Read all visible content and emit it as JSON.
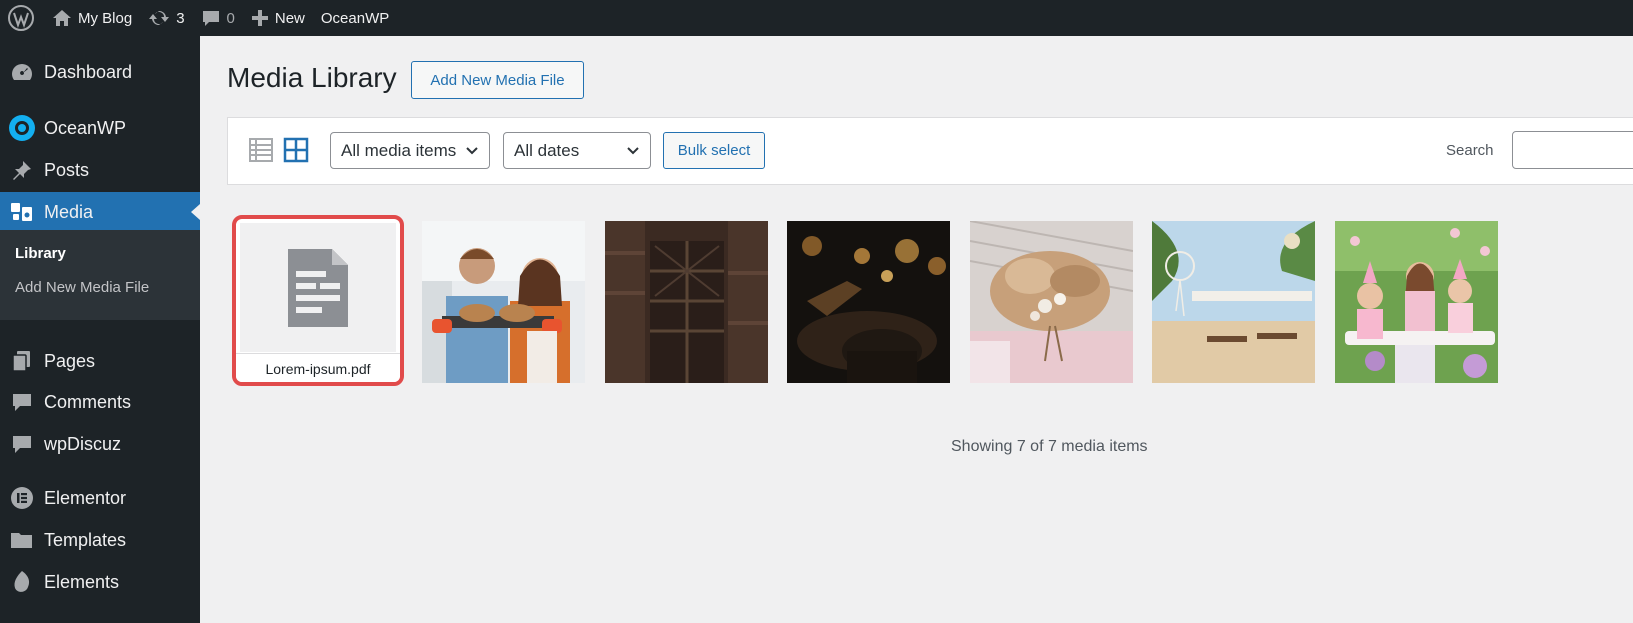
{
  "adminbar": {
    "site_name": "My Blog",
    "updates_count": "3",
    "comments_count": "0",
    "new_label": "New",
    "theme_label": "OceanWP"
  },
  "sidebar": {
    "items": [
      {
        "label": "Dashboard",
        "icon": "dashboard-icon"
      },
      {
        "label": "OceanWP",
        "icon": "oceanwp-icon"
      },
      {
        "label": "Posts",
        "icon": "pin-icon"
      },
      {
        "label": "Media",
        "icon": "media-icon"
      },
      {
        "label": "Pages",
        "icon": "pages-icon"
      },
      {
        "label": "Comments",
        "icon": "comment-icon"
      },
      {
        "label": "wpDiscuz",
        "icon": "comment-icon"
      },
      {
        "label": "Elementor",
        "icon": "elementor-icon"
      },
      {
        "label": "Templates",
        "icon": "folder-icon"
      },
      {
        "label": "Elements",
        "icon": "elements-icon"
      }
    ],
    "submenu": [
      "Library",
      "Add New Media File"
    ]
  },
  "page": {
    "title": "Media Library",
    "add_new": "Add New Media File"
  },
  "toolbar": {
    "type_filter": "All media items",
    "date_filter": "All dates",
    "bulk_select": "Bulk select",
    "search_label": "Search"
  },
  "media": {
    "pdf_name": "Lorem-ipsum.pdf",
    "images": [
      {
        "name": "bakers-with-bread"
      },
      {
        "name": "dark-doorway"
      },
      {
        "name": "night-bokeh-lamp"
      },
      {
        "name": "pampas-grass-decor"
      },
      {
        "name": "beach-wedding-setup"
      },
      {
        "name": "kids-birthday-party"
      }
    ],
    "showing": "Showing 7 of 7 media items"
  },
  "colors": {
    "accent": "#2271b1",
    "admin_dark": "#1d2327",
    "highlight": "#e14b4b"
  }
}
